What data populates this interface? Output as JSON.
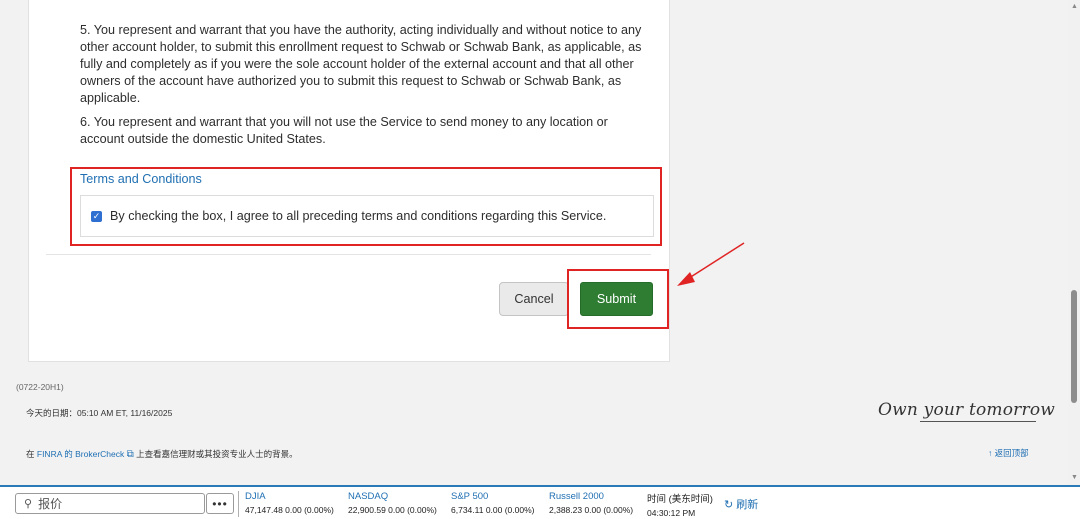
{
  "terms": {
    "para5": "5. You represent and warrant that you have the authority, acting individually and without notice to any other account holder, to submit this enrollment request to Schwab or Schwab Bank, as applicable, as fully and completely as if you were the sole account holder of the external account and that all other owners of the account have authorized you to submit this request to Schwab or Schwab Bank, as applicable.",
    "para6": "6. You represent and warrant that you will not use the Service to send money to any location or account outside the domestic United States.",
    "title": "Terms and Conditions",
    "agree_label": "By checking the box, I agree to all preceding terms and conditions regarding this Service.",
    "agree_checked": true
  },
  "actions": {
    "cancel_label": "Cancel",
    "submit_label": "Submit",
    "submit_color": "#2e7d32"
  },
  "footer": {
    "code": "(0722-20H1)",
    "date": "今天的日期：05:10 AM ET, 11/16/2025",
    "finra_prefix": "在 ",
    "finra_link": "FINRA 的 BrokerCheck",
    "finra_suffix": " 上查看嘉信理财或其投资专业人士的背景。",
    "tagline": "Own your tomorrow",
    "back_to_top": "返回顶部"
  },
  "ticker": {
    "search_placeholder": "报价",
    "more_label": "•••",
    "indices": [
      {
        "name": "DJIA",
        "value": "47,147.48 0.00 (0.00%)"
      },
      {
        "name": "NASDAQ",
        "value": "22,900.59 0.00 (0.00%)"
      },
      {
        "name": "S&P 500",
        "value": "6,734.11 0.00 (0.00%)"
      },
      {
        "name": "Russell 2000",
        "value": "2,388.23 0.00 (0.00%)"
      }
    ],
    "time_label": "时间 (美东时间)",
    "time_value": "04:30:12 PM",
    "refresh_label": "刷新"
  },
  "colors": {
    "accent": "#1f6fb2",
    "highlight": "#e02424"
  }
}
